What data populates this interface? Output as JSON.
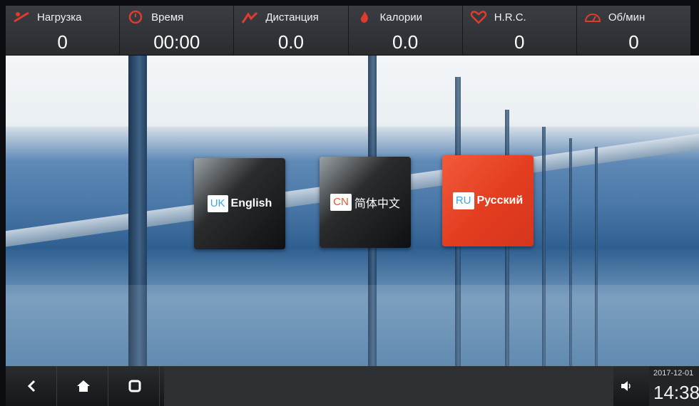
{
  "stats": [
    {
      "label": "Нагрузка",
      "value": "0",
      "icon": "incline-icon"
    },
    {
      "label": "Время",
      "value": "00:00",
      "icon": "timer-icon"
    },
    {
      "label": "Дистанция",
      "value": "0.0",
      "icon": "distance-icon"
    },
    {
      "label": "Калории",
      "value": "0.0",
      "icon": "flame-icon"
    },
    {
      "label": "H.R.C.",
      "value": "0",
      "icon": "heart-icon"
    },
    {
      "label": "Об/мин",
      "value": "0",
      "icon": "speedometer-icon"
    }
  ],
  "languages": [
    {
      "code": "UK",
      "name": "English",
      "code_color": "#3ea6e6"
    },
    {
      "code": "CN",
      "name": "简体中文",
      "code_color": "#e9532f"
    },
    {
      "code": "RU",
      "name": "Русский",
      "code_color": "#3ea6e6"
    }
  ],
  "navbar": {
    "back": "back-icon",
    "home": "home-icon",
    "recent": "recent-apps-icon",
    "volume": "speaker-icon"
  },
  "clock": {
    "date": "2017-12-01",
    "time": "14:38"
  },
  "colors": {
    "accent_red": "#e33c20",
    "icon_red": "#e13b2e",
    "topbar": "#2d2f33"
  }
}
